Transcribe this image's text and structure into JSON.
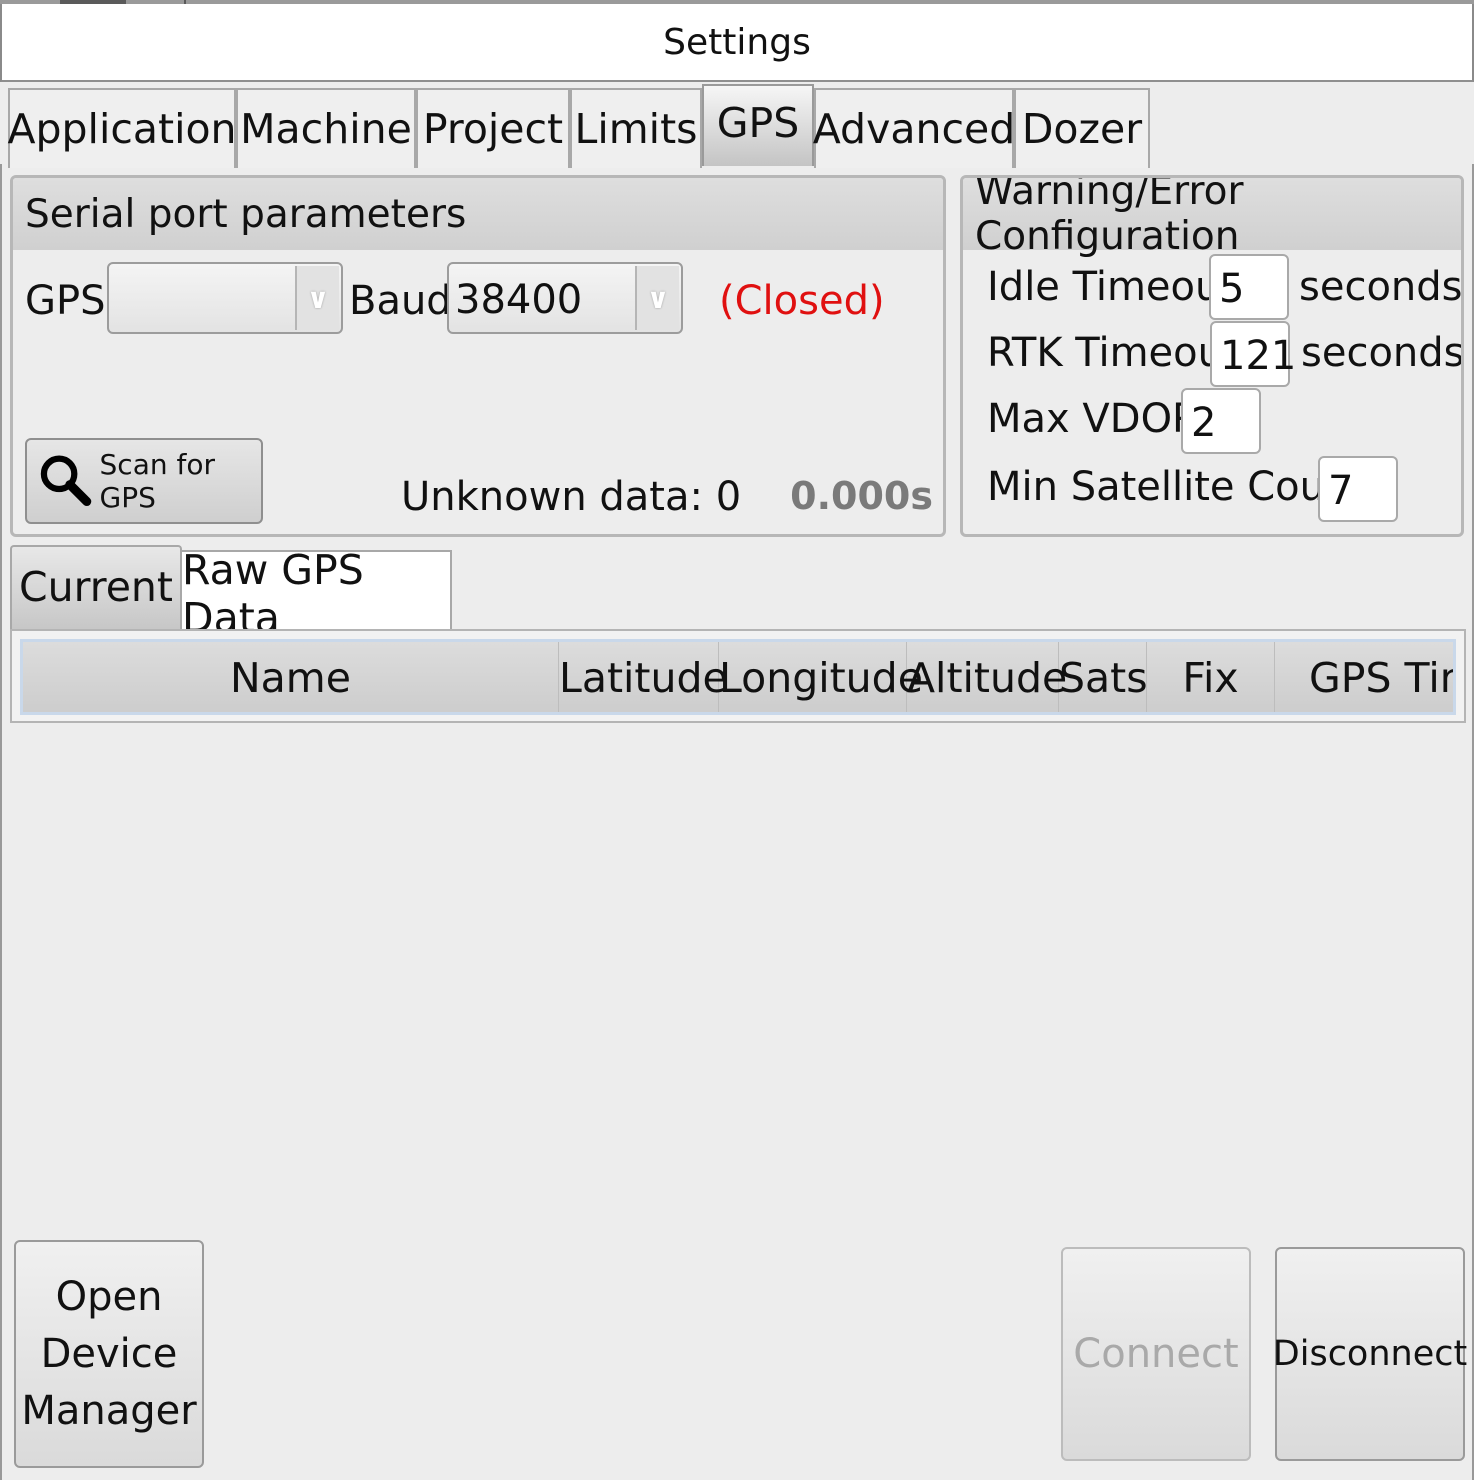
{
  "window": {
    "title": "Settings"
  },
  "tabs": [
    {
      "label": "Application"
    },
    {
      "label": "Machine"
    },
    {
      "label": "Project"
    },
    {
      "label": "Limits"
    },
    {
      "label": "GPS",
      "active": true
    },
    {
      "label": "Advanced"
    },
    {
      "label": "Dozer"
    }
  ],
  "serial": {
    "title": "Serial port parameters",
    "gps_label": "GPS",
    "gps_value": "",
    "baud_label": "Baud:",
    "baud_value": "38400",
    "status": "(Closed)",
    "status_color": "#e01010",
    "scan_label": "Scan for GPS",
    "scan_icon": "search-icon",
    "unknown_data": "Unknown data: 0",
    "elapsed": "0.000s"
  },
  "warning": {
    "title": "Warning/Error Configuration",
    "idle_label": "Idle Timeout",
    "idle_value": "5",
    "idle_unit": "seconds",
    "rtk_label": "RTK Timeout",
    "rtk_value": "121",
    "rtk_unit": "seconds",
    "vdop_label": "Max VDOP",
    "vdop_value": "2",
    "sat_label": "Min Satellite Count",
    "sat_value": "7"
  },
  "subtabs": [
    {
      "label": "Current"
    },
    {
      "label": "Raw GPS Data",
      "active": true
    }
  ],
  "grid": {
    "columns": [
      "Name",
      "Latitude",
      "Longitude",
      "Altitude",
      "Sats",
      "Fix",
      "GPS Time"
    ]
  },
  "buttons": {
    "device_manager": [
      "Open",
      "Device",
      "Manager"
    ],
    "connect": "Connect",
    "disconnect": "Disconnect"
  }
}
